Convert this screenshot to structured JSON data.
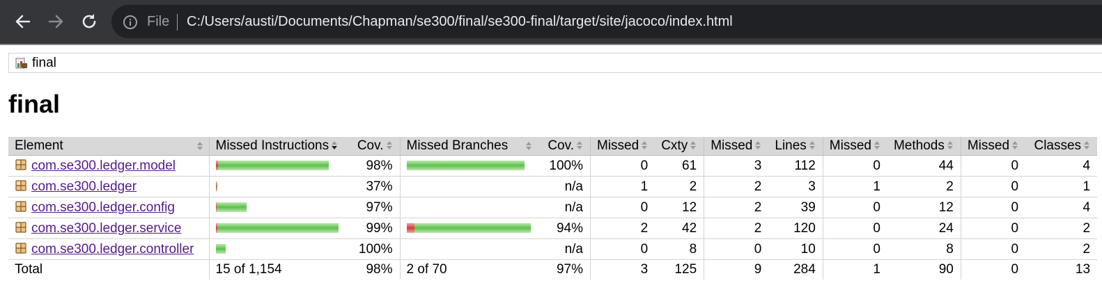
{
  "browser": {
    "file_label": "File",
    "url": "C:/Users/austi/Documents/Chapman/se300/final/se300-final/target/site/jacoco/index.html"
  },
  "breadcrumb": {
    "label": "final"
  },
  "page_title": "final",
  "table": {
    "headers": {
      "element": "Element",
      "missed_instructions": "Missed Instructions",
      "instr_cov": "Cov.",
      "missed_branches": "Missed Branches",
      "branch_cov": "Cov.",
      "cxty_missed": "Missed",
      "cxty": "Cxty",
      "lines_missed": "Missed",
      "lines": "Lines",
      "methods_missed": "Missed",
      "methods": "Methods",
      "classes_missed": "Missed",
      "classes": "Classes"
    },
    "rows": [
      {
        "name": "com.se300.ledger.model",
        "instr_bar": {
          "missed_fraction": 0.02,
          "covered_fraction": 0.98,
          "relative_size": 0.92
        },
        "instr_cov": "98%",
        "branch_bar": {
          "missed_fraction": 0.0,
          "covered_fraction": 1.0,
          "relative_size": 0.95
        },
        "branch_cov": "100%",
        "cxty_missed": "0",
        "cxty": "61",
        "lines_missed": "3",
        "lines": "112",
        "methods_missed": "0",
        "methods": "44",
        "classes_missed": "0",
        "classes": "4"
      },
      {
        "name": "com.se300.ledger",
        "instr_bar": {
          "missed_fraction": 0.63,
          "covered_fraction": 0.37,
          "relative_size": 0.01
        },
        "instr_cov": "37%",
        "branch_bar": null,
        "branch_cov": "n/a",
        "cxty_missed": "1",
        "cxty": "2",
        "lines_missed": "2",
        "lines": "3",
        "methods_missed": "1",
        "methods": "2",
        "classes_missed": "0",
        "classes": "1"
      },
      {
        "name": "com.se300.ledger.config",
        "instr_bar": {
          "missed_fraction": 0.03,
          "covered_fraction": 0.97,
          "relative_size": 0.25
        },
        "instr_cov": "97%",
        "branch_bar": null,
        "branch_cov": "n/a",
        "cxty_missed": "0",
        "cxty": "12",
        "lines_missed": "2",
        "lines": "39",
        "methods_missed": "0",
        "methods": "12",
        "classes_missed": "0",
        "classes": "4"
      },
      {
        "name": "com.se300.ledger.service",
        "instr_bar": {
          "missed_fraction": 0.01,
          "covered_fraction": 0.99,
          "relative_size": 1.0
        },
        "instr_cov": "99%",
        "branch_bar": {
          "missed_fraction": 0.06,
          "covered_fraction": 0.94,
          "relative_size": 1.0
        },
        "branch_cov": "94%",
        "cxty_missed": "2",
        "cxty": "42",
        "lines_missed": "2",
        "lines": "120",
        "methods_missed": "0",
        "methods": "24",
        "classes_missed": "0",
        "classes": "2"
      },
      {
        "name": "com.se300.ledger.controller",
        "instr_bar": {
          "missed_fraction": 0.0,
          "covered_fraction": 1.0,
          "relative_size": 0.08
        },
        "instr_cov": "100%",
        "branch_bar": null,
        "branch_cov": "n/a",
        "cxty_missed": "0",
        "cxty": "8",
        "lines_missed": "0",
        "lines": "10",
        "methods_missed": "0",
        "methods": "8",
        "classes_missed": "0",
        "classes": "2"
      }
    ],
    "total": {
      "label": "Total",
      "missed_instructions": "15 of 1,154",
      "instr_cov": "98%",
      "missed_branches": "2 of 70",
      "branch_cov": "97%",
      "cxty_missed": "3",
      "cxty": "125",
      "lines_missed": "9",
      "lines": "284",
      "methods_missed": "1",
      "methods": "90",
      "classes_missed": "0",
      "classes": "13"
    }
  },
  "colors": {
    "covered_bar": "#5bbf4b",
    "missed_bar": "#d8393e",
    "link": "#551a8b",
    "header_bg": "#d8d8d8"
  }
}
